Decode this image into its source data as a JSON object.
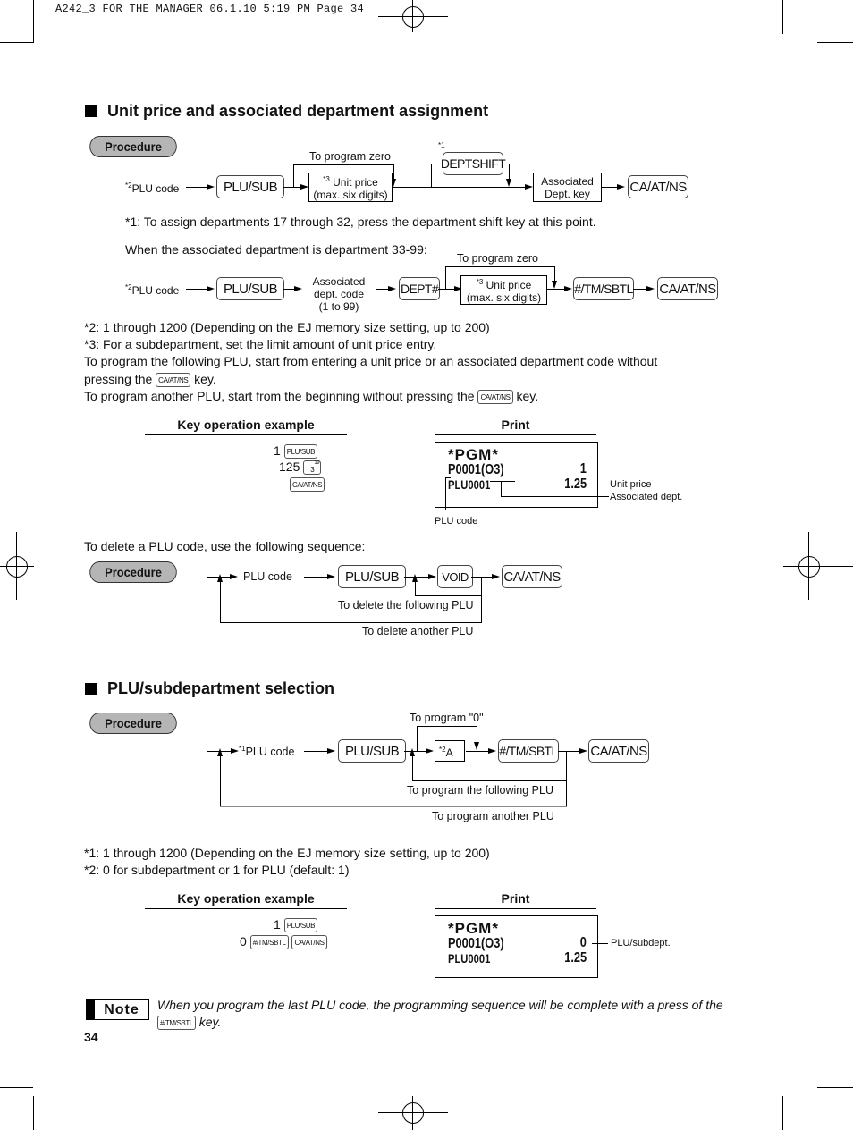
{
  "header": {
    "slug": "A242_3 FOR THE MANAGER  06.1.10 5:19 PM  Page 34"
  },
  "section1": {
    "title": "Unit price and associated department assignment",
    "procedure_label": "Procedure",
    "flow1": {
      "plu_code": "PLU code",
      "plu_code_mark": "*2",
      "plu_sub_key": "PLU/SUB",
      "to_program_zero": "To program zero",
      "unit_price_mark": "*3",
      "unit_price_l1": "Unit price",
      "unit_price_l2": "(max. six digits)",
      "deptshift_mark": "*1",
      "deptshift_key": "DEPTSHIFT",
      "assoc_dept_l1": "Associated",
      "assoc_dept_l2": "Dept. key",
      "ca_key": "CA/AT/NS"
    },
    "footnote1": "*1: To assign departments 17 through 32, press the department shift key at this point.",
    "dept_33_99_intro": "When the associated department is department 33-99:",
    "flow2": {
      "plu_code": "PLU code",
      "plu_code_mark": "*2",
      "plu_sub_key": "PLU/SUB",
      "assoc_code_l1": "Associated",
      "assoc_code_l2": "dept. code",
      "assoc_code_l3": "(1 to 99)",
      "dept_key": "DEPT#",
      "to_program_zero": "To program zero",
      "unit_price_mark": "*3",
      "unit_price_l1": "Unit price",
      "unit_price_l2": "(max. six digits)",
      "tm_key": "#/TM/SBTL",
      "ca_key": "CA/AT/NS"
    },
    "notes": [
      "*2: 1 through 1200 (Depending on the EJ memory size setting, up to 200)",
      "*3: For a subdepartment, set the limit amount of unit price entry.",
      "To program the following PLU, start from entering a unit price or an associated department code without",
      "pressing the",
      "key.",
      "To program another PLU, start from the beginning without pressing the",
      "key."
    ],
    "inline_key": "CA/AT/NS",
    "example": {
      "key_op_header": "Key operation example",
      "print_header": "Print",
      "ops": [
        {
          "num": "1",
          "key": "PLU/SUB"
        },
        {
          "num": "125",
          "key": "3",
          "key_sup": "19"
        },
        {
          "num": "",
          "key": "CA/AT/NS"
        }
      ],
      "receipt": {
        "title": "*PGM*",
        "line1_left": "P0001(O3)",
        "line1_right": "1",
        "line2_left": "PLU0001",
        "line2_right": "1.25"
      },
      "callouts": {
        "unit_price": "Unit price",
        "assoc_dept": "Associated dept.",
        "plu_code": "PLU code"
      }
    },
    "delete": {
      "intro": "To delete a PLU code, use the following sequence:",
      "procedure_label": "Procedure",
      "plu_code": "PLU code",
      "plu_sub_key": "PLU/SUB",
      "void_key": "VOID",
      "ca_key": "CA/AT/NS",
      "loop_following": "To delete the following PLU",
      "loop_another": "To delete another PLU"
    }
  },
  "section2": {
    "title": "PLU/subdepartment selection",
    "procedure_label": "Procedure",
    "flow": {
      "plu_code_mark": "*1",
      "plu_code": "PLU code",
      "plu_sub_key": "PLU/SUB",
      "to_program_0": "To program \"0\"",
      "a_mark": "*2",
      "a_label": "A",
      "tm_key": "#/TM/SBTL",
      "ca_key": "CA/AT/NS",
      "loop_following": "To program the following PLU",
      "loop_another": "To program another PLU"
    },
    "notes": [
      "*1: 1 through 1200 (Depending on the EJ memory size setting, up to 200)",
      "*2: 0 for subdepartment or 1 for PLU (default: 1)"
    ],
    "example": {
      "key_op_header": "Key operation example",
      "print_header": "Print",
      "ops": [
        {
          "num": "1",
          "key": "PLU/SUB"
        },
        {
          "num": "0",
          "key": "#/TM/SBTL",
          "key2": "CA/AT/NS"
        }
      ],
      "receipt": {
        "title": "*PGM*",
        "line1_left": "P0001(O3)",
        "line1_right": "0",
        "line2_left": "PLU0001",
        "line2_right": "1.25"
      },
      "callouts": {
        "plu_subdept": "PLU/subdept."
      }
    }
  },
  "note": {
    "badge": "Note",
    "text_before": "When you program the last PLU code, the programming sequence will be complete with a press of the",
    "key": "#/TM/SBTL",
    "text_after": "key."
  },
  "page_number": "34"
}
